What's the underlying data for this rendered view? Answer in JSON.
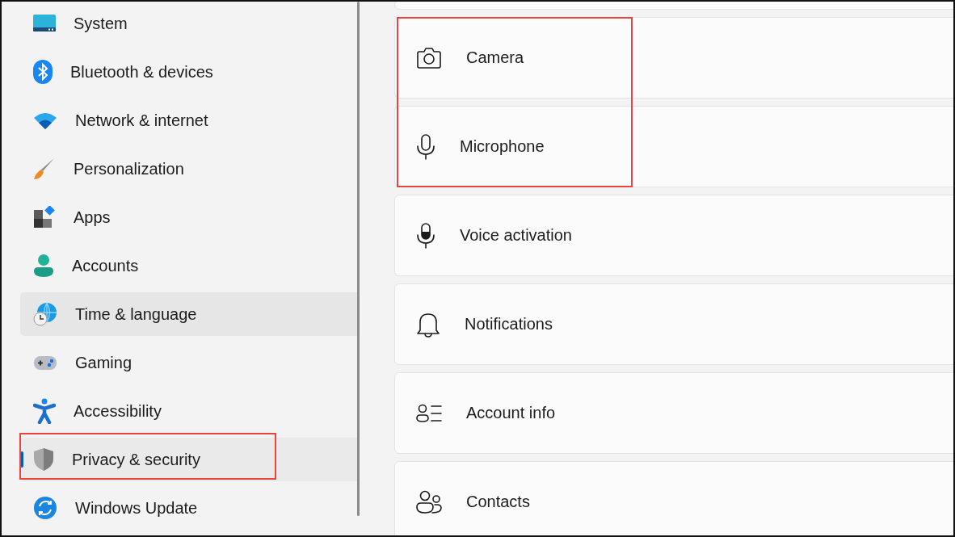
{
  "sidebar": {
    "items": [
      {
        "label": "System",
        "kind": "system",
        "selected": false,
        "hovered": false,
        "annotated": false
      },
      {
        "label": "Bluetooth & devices",
        "kind": "bluetooth",
        "selected": false,
        "hovered": false,
        "annotated": false
      },
      {
        "label": "Network & internet",
        "kind": "wifi",
        "selected": false,
        "hovered": false,
        "annotated": false
      },
      {
        "label": "Personalization",
        "kind": "brush",
        "selected": false,
        "hovered": false,
        "annotated": false
      },
      {
        "label": "Apps",
        "kind": "apps",
        "selected": false,
        "hovered": false,
        "annotated": false
      },
      {
        "label": "Accounts",
        "kind": "person",
        "selected": false,
        "hovered": false,
        "annotated": false
      },
      {
        "label": "Time & language",
        "kind": "globe",
        "selected": false,
        "hovered": true,
        "annotated": false
      },
      {
        "label": "Gaming",
        "kind": "gamepad",
        "selected": false,
        "hovered": false,
        "annotated": false
      },
      {
        "label": "Accessibility",
        "kind": "accessibility",
        "selected": false,
        "hovered": false,
        "annotated": false
      },
      {
        "label": "Privacy & security",
        "kind": "shield",
        "selected": true,
        "hovered": false,
        "annotated": true
      },
      {
        "label": "Windows Update",
        "kind": "update",
        "selected": false,
        "hovered": false,
        "annotated": false
      }
    ]
  },
  "content": {
    "cut_card_above": true,
    "cards": [
      {
        "label": "Camera",
        "kind": "camera",
        "annotated": true
      },
      {
        "label": "Microphone",
        "kind": "mic",
        "annotated": true
      },
      {
        "label": "Voice activation",
        "kind": "voice",
        "annotated": false
      },
      {
        "label": "Notifications",
        "kind": "bell",
        "annotated": false
      },
      {
        "label": "Account info",
        "kind": "accountinfo",
        "annotated": false
      },
      {
        "label": "Contacts",
        "kind": "contacts",
        "annotated": false
      }
    ]
  }
}
